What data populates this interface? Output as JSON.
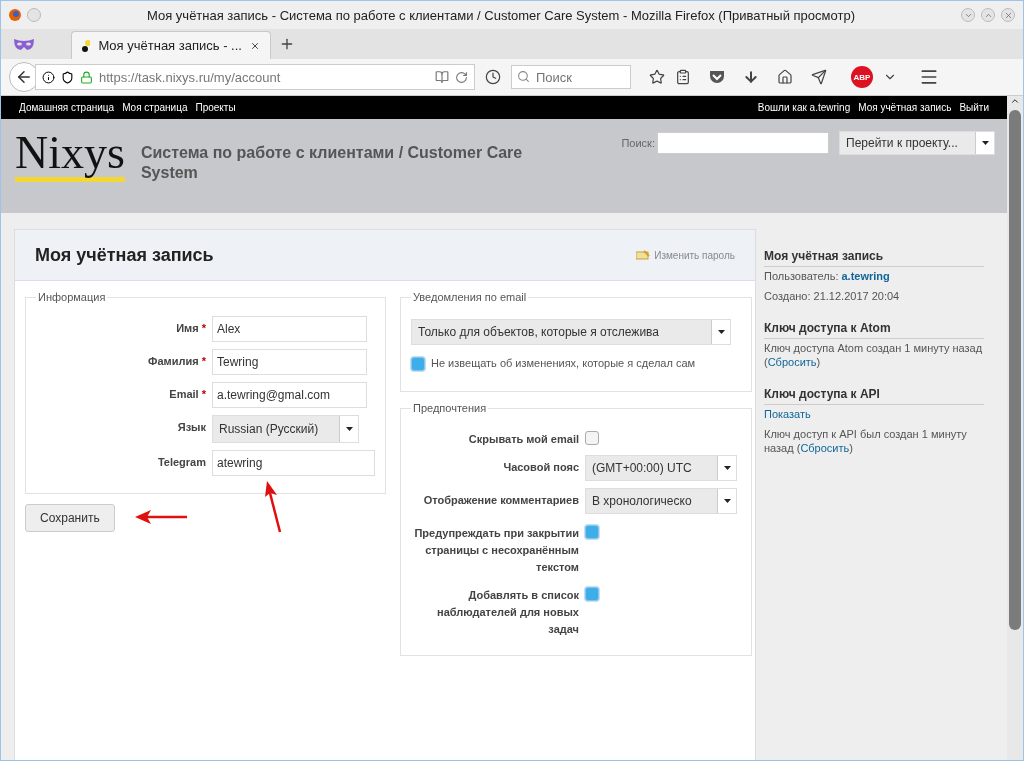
{
  "window": {
    "title": "Моя учётная запись - Система по работе с клиентами / Customer Care System - Mozilla Firefox (Приватный просмотр)"
  },
  "browser": {
    "tabs": [
      {
        "title": "Моя учётная запись - ...",
        "selected": true
      }
    ],
    "url": "https://task.nixys.ru/my/account",
    "search": {
      "placeholder": "Поиск"
    },
    "adblock_label": "ABP"
  },
  "site": {
    "top_menu_left": [
      "Домашняя страница",
      "Моя страница",
      "Проекты"
    ],
    "top_menu_right": [
      "Вошли как a.tewring",
      "Моя учётная запись",
      "Выйти"
    ],
    "logo": "Nixys",
    "title": "Система по работе с клиентами / Customer Care System",
    "search_label": "Поиск:",
    "project_jump": "Перейти к проекту..."
  },
  "content": {
    "title": "Моя учётная запись",
    "change_password": "Изменить пароль",
    "info": {
      "legend": "Информация",
      "fields": [
        {
          "kind": "text",
          "label": "Имя",
          "required_mark": "*",
          "value": "Alex"
        },
        {
          "kind": "text",
          "label": "Фамилия",
          "required_mark": "*",
          "value": "Tewring"
        },
        {
          "kind": "text",
          "label": "Email",
          "required_mark": "*",
          "value": "a.tewring@gmal.com"
        },
        {
          "kind": "select",
          "label": "Язык",
          "value": "Russian (Русский)"
        },
        {
          "kind": "text",
          "label": "Telegram",
          "value": "atewring"
        }
      ]
    },
    "save_button": "Сохранить",
    "notifications": {
      "legend": "Уведомления по email",
      "select": "Только для объектов, которые я отслежива",
      "checkbox": {
        "label": "Не извещать об изменениях, которые я сделал сам",
        "checked": true
      }
    },
    "preferences": {
      "legend": "Предпочтения",
      "items": [
        {
          "kind": "checkbox",
          "label": "Скрывать мой email",
          "checked": false
        },
        {
          "kind": "select",
          "label": "Часовой пояс",
          "value": "(GMT+00:00) UTC"
        },
        {
          "kind": "select",
          "label": "Отображение комментариев",
          "value": "В хронологическо"
        },
        {
          "kind": "checkbox",
          "label": "Предупреждать при закрытии страницы с несохранённым текстом",
          "checked": true
        },
        {
          "kind": "checkbox",
          "label": "Добавлять в список наблюдателей для новых задач",
          "checked": true
        }
      ]
    }
  },
  "sidebar": [
    {
      "heading": "Моя учётная запись",
      "paragraphs": [
        {
          "text": "Пользователь: ",
          "link": "a.tewring",
          "bold": true
        },
        {
          "text": "Создано: 21.12.2017 20:04"
        }
      ]
    },
    {
      "heading": "Ключ доступа к Atom",
      "paragraphs": [
        {
          "text": "Ключ доступа Atom создан 1 минуту назад (",
          "link": "Сбросить",
          "after": ")"
        }
      ]
    },
    {
      "heading": "Ключ доступа к API",
      "paragraphs": [
        {
          "link": "Показать"
        },
        {
          "text": "Ключ доступ к API был создан 1 минуту назад (",
          "link": "Сбросить",
          "after": ")"
        }
      ]
    }
  ]
}
